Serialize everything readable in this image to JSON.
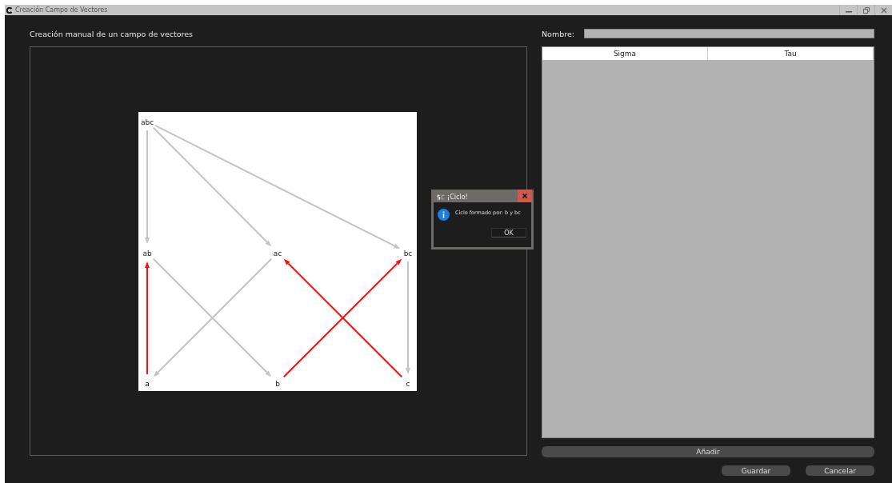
{
  "window": {
    "title": "Creación Campo de Vectores"
  },
  "canvas": {
    "heading": "Creación manual de un campo de vectores",
    "levels": [
      [
        {
          "label": "abc"
        }
      ],
      [
        {
          "label": "ab"
        },
        {
          "label": "ac"
        },
        {
          "label": "bc"
        }
      ],
      [
        {
          "label": "a"
        },
        {
          "label": "b"
        },
        {
          "label": "c"
        }
      ]
    ],
    "edges": [
      {
        "highlighted": false
      },
      {
        "highlighted": false
      },
      {
        "highlighted": false
      },
      {
        "highlighted": false
      },
      {
        "highlighted": false
      },
      {
        "highlighted": false
      },
      {
        "highlighted": true
      },
      {
        "highlighted": true
      },
      {
        "highlighted": true
      }
    ]
  },
  "name_field": {
    "label": "Nombre:"
  },
  "table": {
    "columns": [
      "Sigma",
      "Tau"
    ]
  },
  "buttons": {
    "add": "Añadir",
    "save": "Guardar",
    "cancel": "Cancelar"
  },
  "dialog": {
    "title": "¡Ciclo!",
    "message": "Ciclo formado por: b y bc",
    "ok": "OK"
  }
}
